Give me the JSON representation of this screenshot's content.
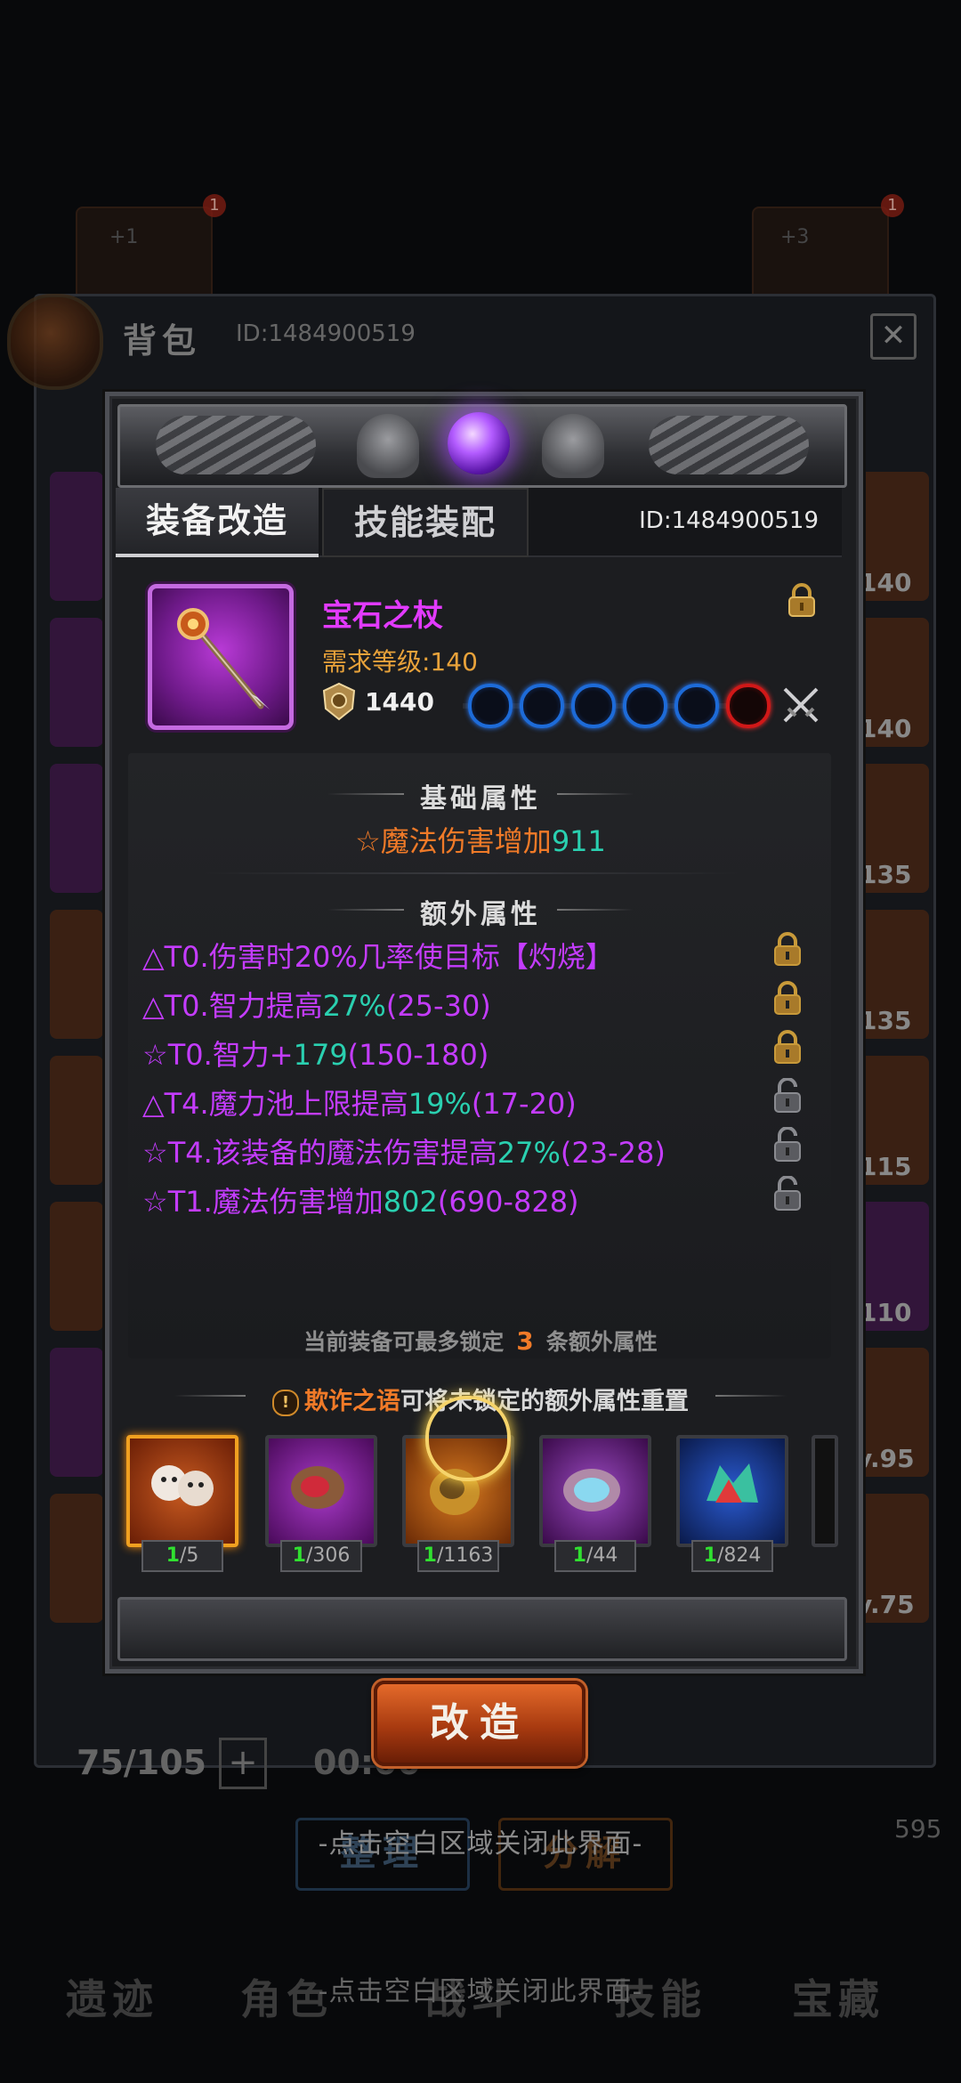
{
  "background": {
    "bag_title": "背包",
    "bag_id": "ID:1484900519",
    "close_glyph": "✕",
    "top_badges": [
      "1",
      "1"
    ],
    "top_slot_texts": [
      "+1",
      "+3"
    ],
    "right_levels": [
      "140",
      "140",
      "135",
      "135",
      "115",
      "110",
      "v.95",
      "v.75"
    ],
    "capacity": "75/105",
    "plus": "+",
    "timer": "00:00",
    "corner_num": "595",
    "sort_button": "整理",
    "decompose_button": "分解",
    "nav": [
      "遗迹",
      "角色",
      "战斗",
      "技能",
      "宝藏"
    ],
    "close_hint": "-点击空白区域关闭此界面-"
  },
  "tabs": {
    "modify": "装备改造",
    "skill": "技能装配",
    "id": "ID:1484900519"
  },
  "item": {
    "name": "宝石之杖",
    "level": "需求等级:140",
    "power": "1440",
    "sockets": [
      "blue",
      "blue",
      "blue",
      "blue",
      "blue",
      "red"
    ]
  },
  "base": {
    "title": "基础属性",
    "attr_prefix": "☆魔法伤害增加",
    "attr_value": "911"
  },
  "extra": {
    "title": "额外属性",
    "rows": [
      {
        "pre": "△T0.伤害时20%几率使目标【灼烧】",
        "val": "",
        "post": "",
        "locked": true
      },
      {
        "pre": "△T0.智力提高",
        "val": "27%",
        "post": "(25-30)",
        "locked": true
      },
      {
        "pre": "☆T0.智力+",
        "val": "179",
        "post": "(150-180)",
        "locked": true
      },
      {
        "pre": "△T4.魔力池上限提高",
        "val": "19%",
        "post": "(17-20)",
        "locked": false
      },
      {
        "pre": "☆T4.该装备的魔法伤害提高",
        "val": "27%",
        "post": "(23-28)",
        "locked": false
      },
      {
        "pre": "☆T1.魔法伤害增加",
        "val": "802",
        "post": "(690-828)",
        "locked": false
      }
    ],
    "note_pre": "当前装备可最多锁定",
    "note_num": "3",
    "note_post": "条额外属性"
  },
  "material": {
    "warn_glyph": "!",
    "name": "欺诈之语",
    "desc": "可将未锁定的额外属性重置",
    "items": [
      {
        "icon": "masks-icon",
        "cur": "1",
        "total": "/5"
      },
      {
        "icon": "red-ore-icon",
        "cur": "1",
        "total": "/306"
      },
      {
        "icon": "gold-ore-icon",
        "cur": "1",
        "total": "/1163"
      },
      {
        "icon": "crystal-geode-icon",
        "cur": "1",
        "total": "/44"
      },
      {
        "icon": "gem-cluster-icon",
        "cur": "1",
        "total": "/824"
      }
    ]
  },
  "action": {
    "modify_button": "改造"
  },
  "colors": {
    "item_name": "#e23aff",
    "attr_purple": "#c43cff",
    "highlight": "#2ad0b0",
    "orange": "#f07a28",
    "socket_blue": "#1d6bd8",
    "socket_red": "#d01818"
  }
}
